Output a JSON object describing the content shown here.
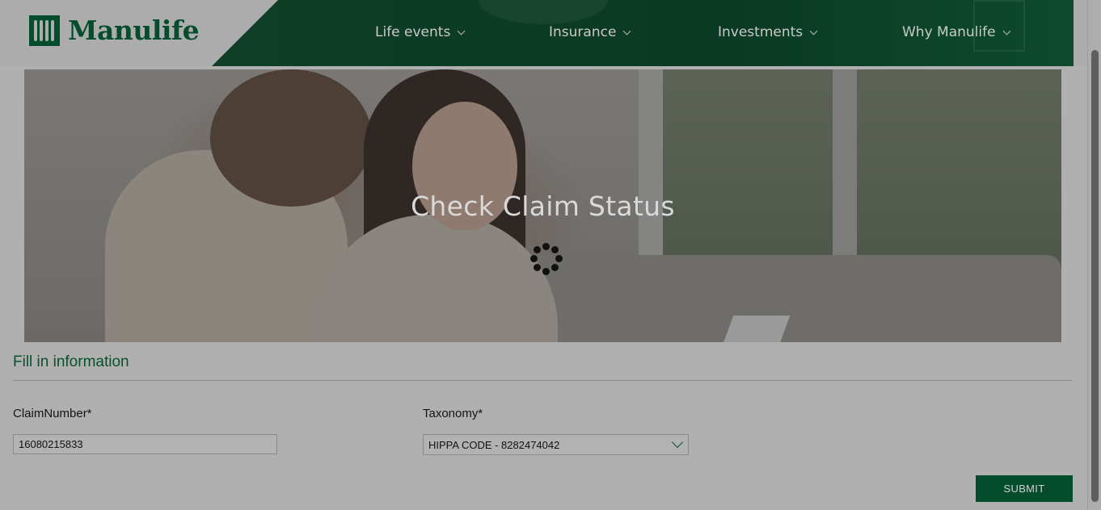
{
  "header": {
    "logo_text": "Manulife",
    "nav": [
      {
        "label": "Life events"
      },
      {
        "label": "Insurance"
      },
      {
        "label": "Investments"
      },
      {
        "label": "Why Manulife"
      }
    ]
  },
  "hero": {
    "title": "Check Claim Status"
  },
  "form": {
    "section_title": "Fill in information",
    "claim_number_label": "ClaimNumber*",
    "claim_number_value": "16080215833",
    "taxonomy_label": "Taxonomy*",
    "taxonomy_value": "HIPPA CODE - 8282474042",
    "submit_label": "SUBMIT"
  },
  "colors": {
    "brand_green": "#034d2d",
    "overlay_gray": "#b0b0b0"
  },
  "icons": [
    "manulife-logo-icon",
    "chevron-down-icon",
    "loading-spinner-icon"
  ]
}
